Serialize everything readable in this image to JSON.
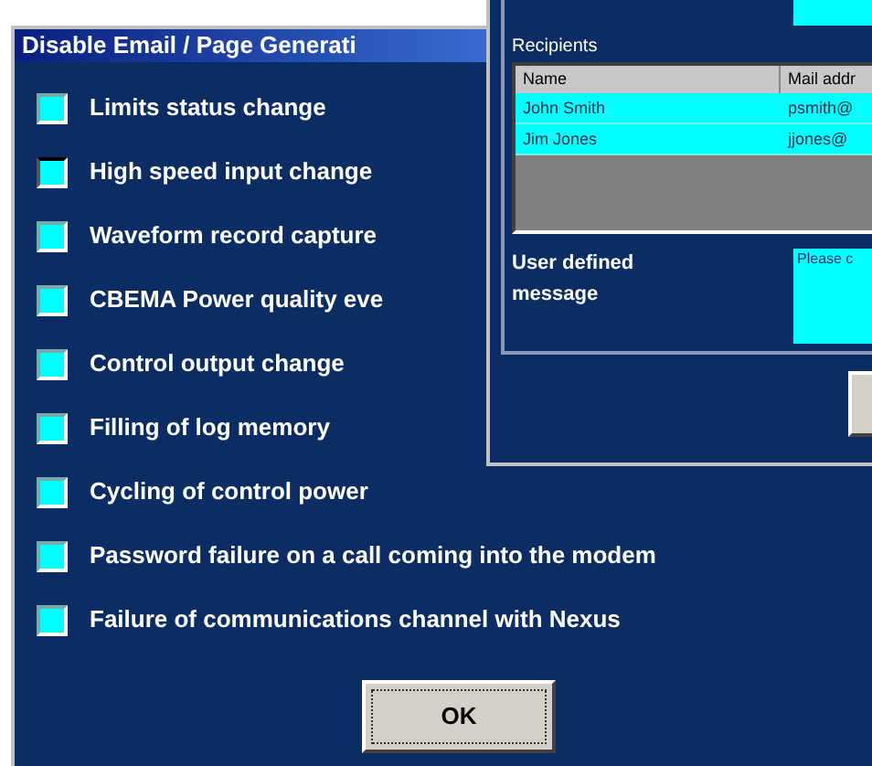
{
  "dialog": {
    "title": "Disable Email / Page Generati",
    "options": [
      {
        "label": "Limits status change",
        "checked": false,
        "focused": false
      },
      {
        "label": "High speed input change",
        "checked": false,
        "focused": true
      },
      {
        "label": "Waveform record capture",
        "checked": false,
        "focused": false
      },
      {
        "label": "CBEMA Power quality eve",
        "checked": false,
        "focused": false
      },
      {
        "label": "Control output change",
        "checked": false,
        "focused": false
      },
      {
        "label": "Filling of log memory",
        "checked": false,
        "focused": false
      },
      {
        "label": "Cycling of control power",
        "checked": false,
        "focused": false
      },
      {
        "label": "Password failure on a call coming into the modem",
        "checked": false,
        "focused": false
      },
      {
        "label": "Failure of communications channel with Nexus",
        "checked": false,
        "focused": false
      }
    ],
    "ok_button": "OK"
  },
  "back_window": {
    "recipients_label": "Recipients",
    "table": {
      "columns": [
        "Name",
        "Mail addr"
      ],
      "rows": [
        [
          "John Smith",
          "psmith@"
        ],
        [
          "Jim Jones",
          "jjones@"
        ]
      ]
    },
    "message_label": "User defined message",
    "message_value": "Please c"
  }
}
